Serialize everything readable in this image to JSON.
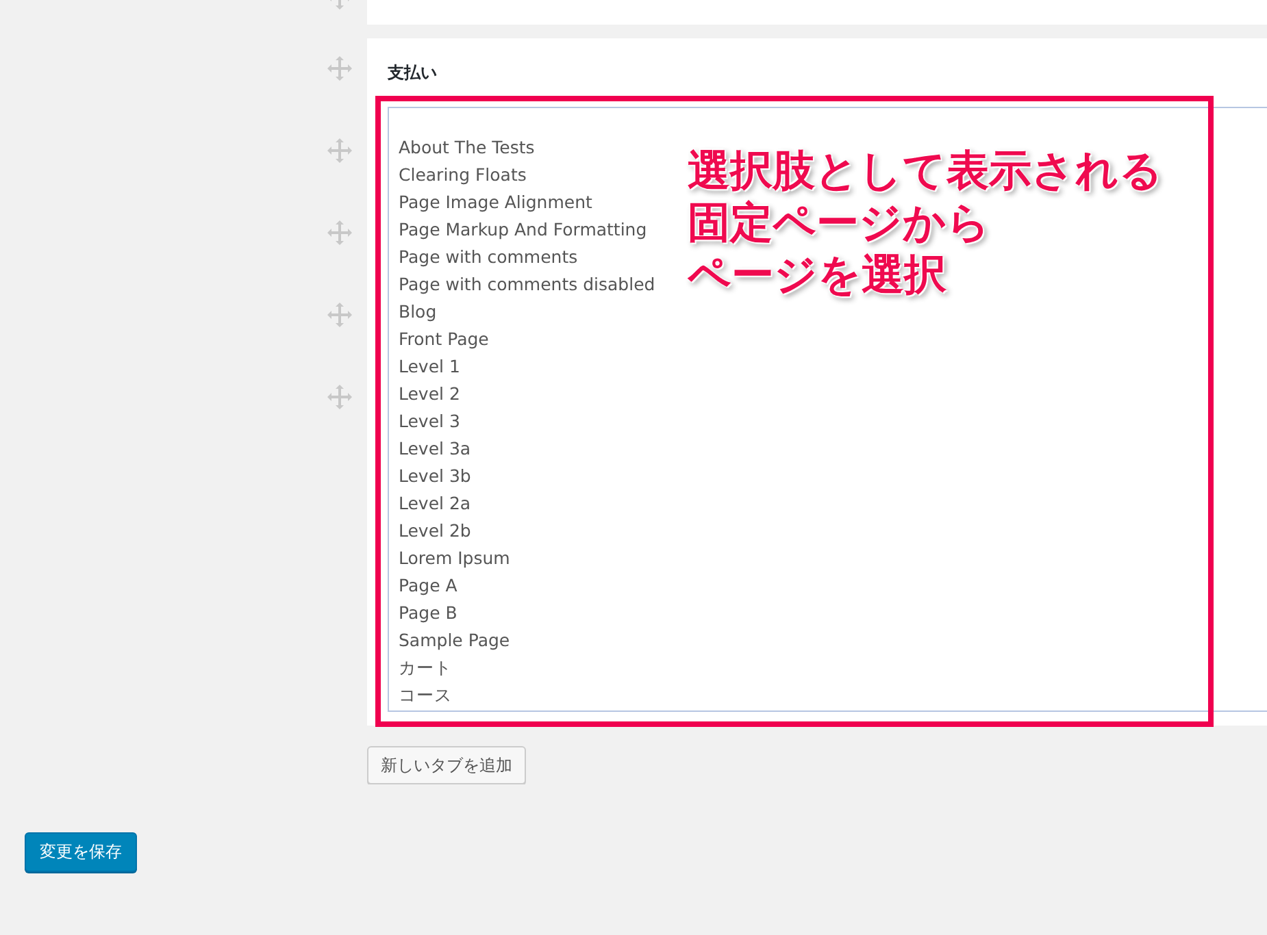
{
  "section": {
    "title": "支払い"
  },
  "page_list": {
    "options": [
      "About The Tests",
      "Clearing Floats",
      "Page Image Alignment",
      "Page Markup And Formatting",
      "Page with comments",
      "Page with comments disabled",
      "Blog",
      "Front Page",
      "Level 1",
      "Level 2",
      "Level 3",
      "Level 3a",
      "Level 3b",
      "Level 2a",
      "Level 2b",
      "Lorem Ipsum",
      "Page A",
      "Page B",
      "Sample Page",
      "カート",
      "コース"
    ]
  },
  "annotation": {
    "lines": [
      "選択肢として表示される",
      "固定ページから",
      "ページを選択"
    ]
  },
  "add_tab_button": "新しいタブを追加",
  "save_button": "変更を保存"
}
